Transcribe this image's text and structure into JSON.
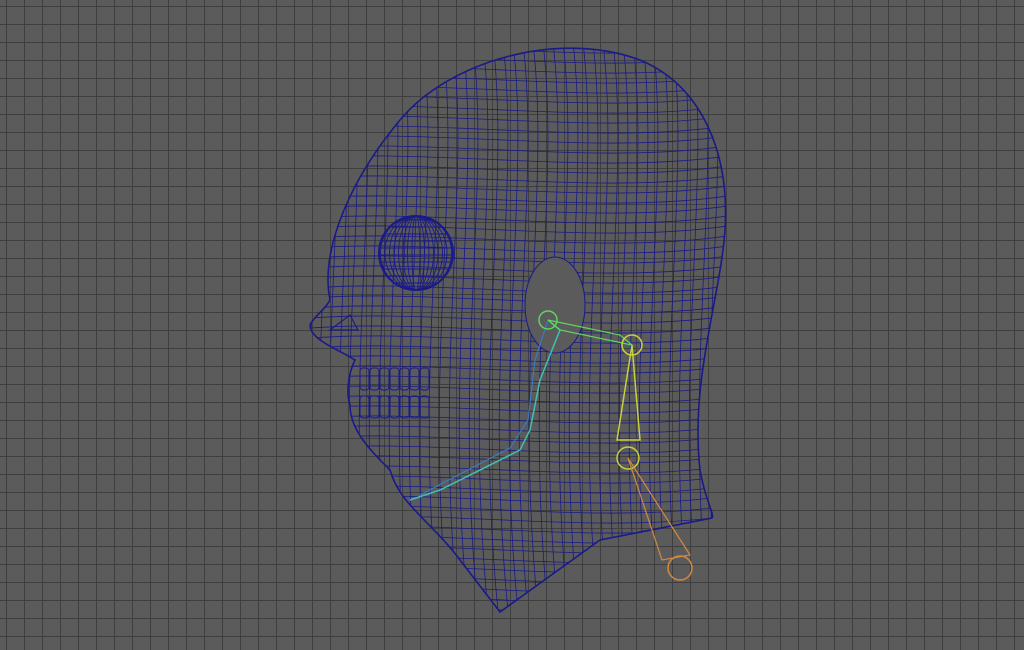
{
  "viewport": {
    "background_color": "#5b5b5b",
    "grid_color": "#3f3f3f",
    "mesh_color": "#1a1a88",
    "joint_colors": [
      "#5fd65f",
      "#3fc0b0",
      "#c8d040",
      "#d08a40",
      "#3a7fd0"
    ]
  },
  "scene": {
    "objects": [
      {
        "name": "head-mesh",
        "display": "wireframe"
      },
      {
        "name": "eyeball",
        "display": "wireframe"
      },
      {
        "name": "teeth",
        "display": "wireframe"
      },
      {
        "name": "jaw-joint-chain",
        "display": "skeleton"
      },
      {
        "name": "neck-joint-chain",
        "display": "skeleton"
      }
    ]
  }
}
